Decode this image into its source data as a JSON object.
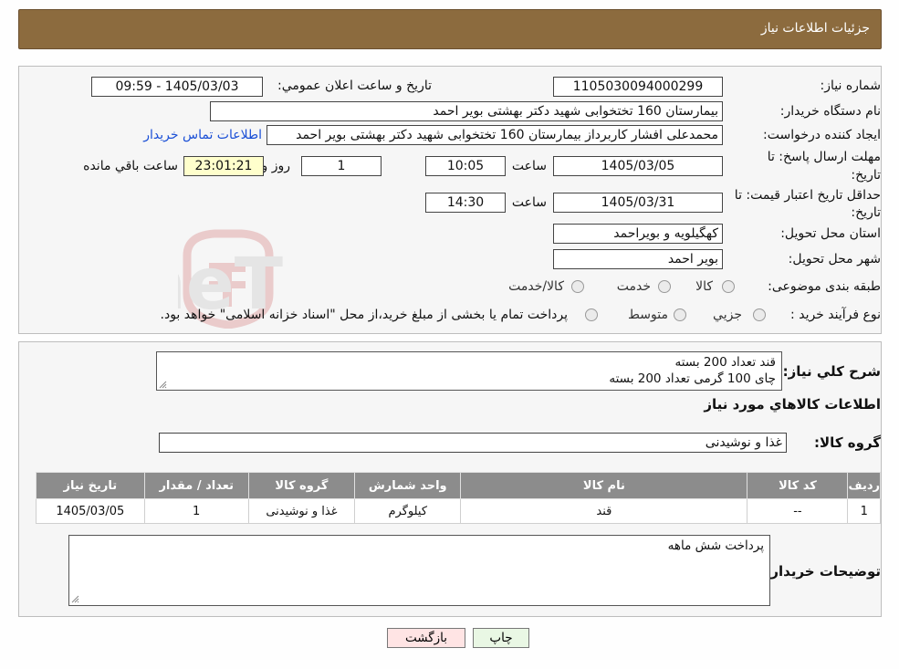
{
  "header": {
    "title": "جزئیات اطلاعات نیاز"
  },
  "details": {
    "need_number_label": "شماره نیاز:",
    "need_number": "1105030094000299",
    "announce_label": "تاریخ و ساعت اعلان عمومي:",
    "announce_value": "1405/03/03 - 09:59",
    "buyer_label": "نام دستگاه خريدار:",
    "buyer_value": "بیمارستان 160 تختخوابی شهید دکتر بهشتی بویر احمد",
    "requester_label": "ایجاد کننده درخواست:",
    "requester_value": "محمدعلی افشار کاربرداز بیمارستان 160 تختخوابی شهید دکتر بهشتی بویر احمد",
    "contact_link": "اطلاعات تماس خريدار",
    "deadline_label_1": "مهلت ارسال پاسخ: تا",
    "deadline_label_2": "تاریخ:",
    "deadline_date": "1405/03/05",
    "time_label": "ساعت",
    "deadline_time": "10:05",
    "days_value": "1",
    "days_label": "روز و",
    "remaining_time": "23:01:21",
    "remaining_label": "ساعت باقي مانده",
    "validity_label_1": "حداقل تاریخ اعتبار قیمت: تا",
    "validity_label_2": "تاریخ:",
    "validity_date": "1405/03/31",
    "validity_time": "14:30",
    "province_label": "استان محل تحویل:",
    "province_value": "کهگیلویه و بویراحمد",
    "city_label": "شهر محل تحویل:",
    "city_value": "بویر احمد",
    "category_label": "طبقه بندی موضوعی:",
    "category_options": [
      "کالا",
      "خدمت",
      "کالا/خدمت"
    ],
    "process_label": "نوع فرآیند خرید :",
    "process_options": [
      "جزيي",
      "متوسط"
    ],
    "process_note": "پرداخت تمام یا بخشی از مبلغ خرید،از محل \"اسناد خزانه اسلامی\" خواهد بود."
  },
  "description": {
    "label": "شرح کلي نياز:",
    "lines": [
      "قند تعداد 200 بسته",
      "چای 100 گرمی تعداد 200 بسته"
    ]
  },
  "goods": {
    "section_title": "اطلاعات کالاهاي مورد نياز",
    "group_label": "گروه کالا:",
    "group_value": "غذا و نوشیدنی",
    "table": {
      "headers": [
        "رديف",
        "کد کالا",
        "نام کالا",
        "واحد شمارش",
        "گروه کالا",
        "تعداد / مقدار",
        "تاریخ نیاز"
      ],
      "rows": [
        [
          "1",
          "--",
          "قند",
          "کیلوگرم",
          "غذا و نوشیدنی",
          "1",
          "1405/03/05"
        ]
      ]
    },
    "buyer_notes_label": "توضیحات خریدار:",
    "buyer_notes": "پرداخت شش ماهه"
  },
  "buttons": {
    "print": "چاپ",
    "back": "بازگشت"
  },
  "watermark": {
    "text": "AriaTender.neT"
  },
  "colors": {
    "header": "#8c6b3e",
    "table_header": "#8c8c8c",
    "link": "#1a4fd6",
    "timer": "#ffffcc",
    "back_button": "#ffe4e4",
    "print_button": "#e9f7e4"
  }
}
